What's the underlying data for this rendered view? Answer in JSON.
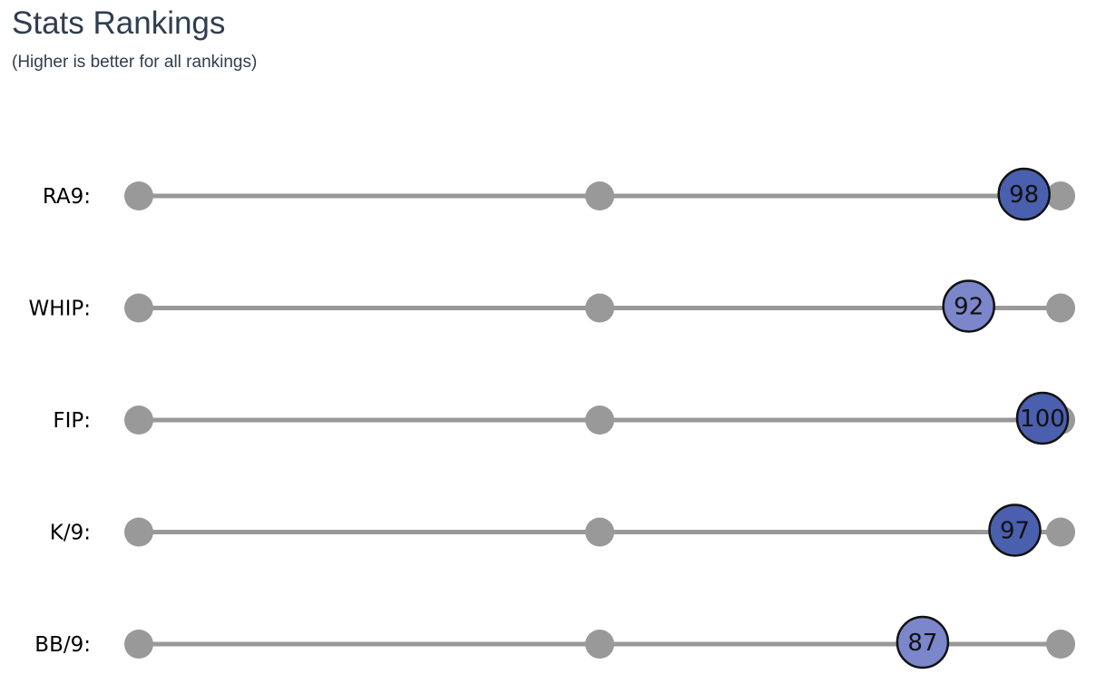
{
  "title": "Stats Rankings",
  "subtitle": "(Higher is better for all rankings)",
  "chart_data": {
    "type": "dot-rank",
    "xlim": [
      0,
      100
    ],
    "track_marks": [
      0,
      50,
      100
    ],
    "rows": [
      {
        "label": "RA9:",
        "value": 98
      },
      {
        "label": "WHIP:",
        "value": 92
      },
      {
        "label": "FIP:",
        "value": 100
      },
      {
        "label": "K/9:",
        "value": 97
      },
      {
        "label": "BB/9:",
        "value": 87
      }
    ],
    "colors": {
      "track": "#999999",
      "marker_high": "#4a5fae",
      "marker_low": "#7b86cb",
      "marker_stroke": "#111111"
    }
  }
}
